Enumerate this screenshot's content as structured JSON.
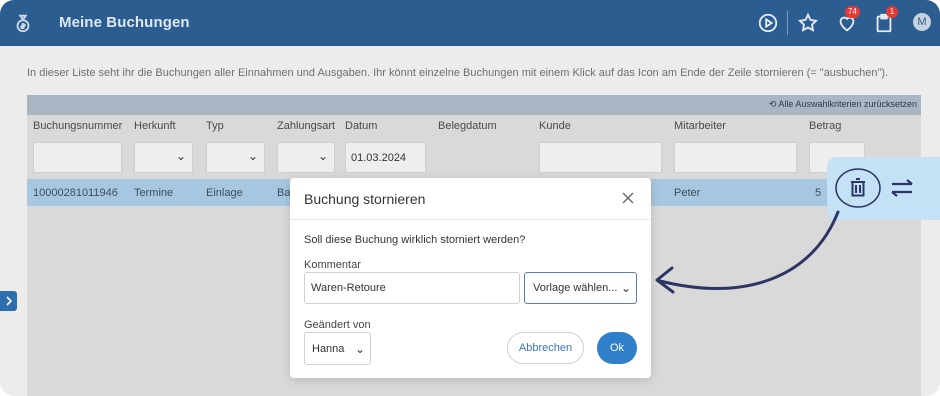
{
  "header": {
    "title": "Meine Buchungen",
    "notifications_badge": "74",
    "clipboard_badge": "1",
    "avatar_initial": "M"
  },
  "intro_text": "In dieser Liste seht ihr die Buchungen aller Einnahmen und Ausgaben. Ihr könnt einzelne Buchungen mit einem Klick auf das Icon am Ende der Zeile stornieren (= \"ausbuchen\").",
  "table": {
    "reset_filters": "Alle Auswahlkriterien zurücksetzen",
    "columns": [
      "Buchungsnummer",
      "Herkunft",
      "Typ",
      "Zahlungsart",
      "Datum",
      "Belegdatum",
      "Kunde",
      "Mitarbeiter",
      "Betrag"
    ],
    "filters": {
      "datum": "01.03.2024"
    },
    "rows": [
      {
        "buchungsnummer": "10000281011946",
        "herkunft": "Termine",
        "typ": "Einlage",
        "zahlungsart": "Ba",
        "mitarbeiter": "Peter",
        "betrag": "5"
      }
    ]
  },
  "modal": {
    "title": "Buchung stornieren",
    "question": "Soll diese Buchung wirklich storniert werden?",
    "comment_label": "Kommentar",
    "comment_value": "Waren-Retoure",
    "template_select": "Vorlage wählen...",
    "changed_by_label": "Geändert von",
    "changed_by_value": "Hanna",
    "cancel_label": "Abbrechen",
    "ok_label": "Ok"
  },
  "colors": {
    "header_bg": "#2b5d90",
    "row_highlight": "#a7c7e1",
    "accent": "#2f80c8",
    "callout_bg": "#c4e1f6",
    "annotation": "#2c3563"
  }
}
